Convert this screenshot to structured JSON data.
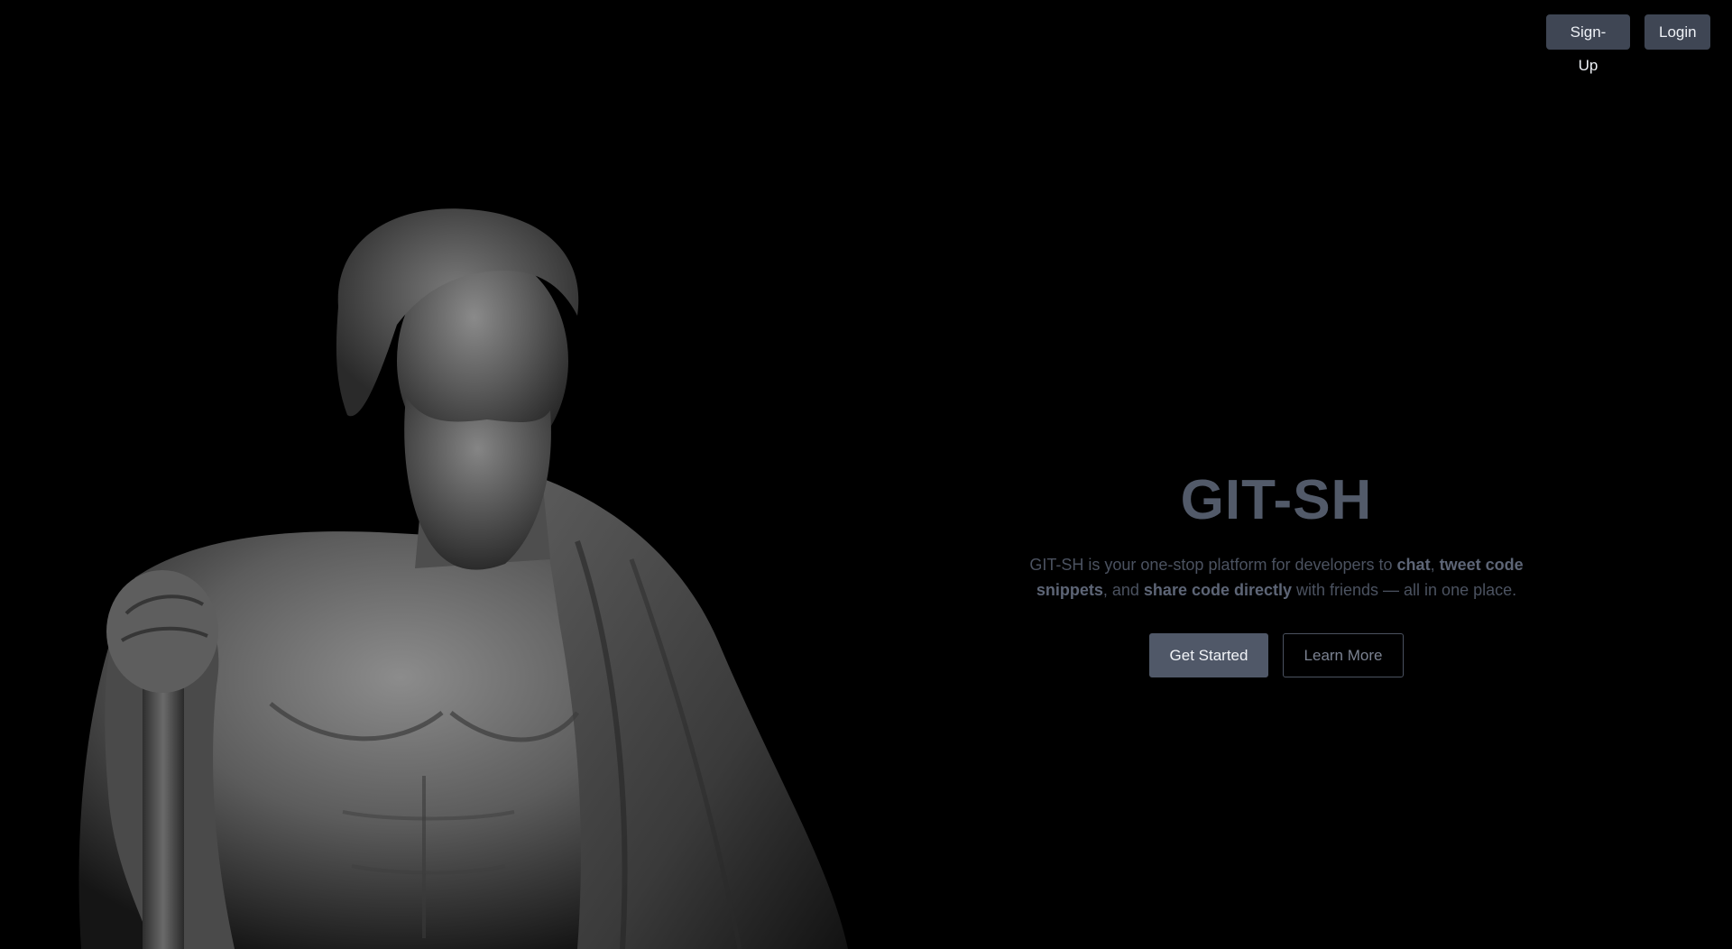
{
  "nav": {
    "signup_label": "Sign-Up",
    "login_label": "Login"
  },
  "hero": {
    "title": "GIT-SH",
    "description": {
      "part1": "GIT-SH is your one-stop platform for developers to ",
      "bold1": "chat",
      "part2": ", ",
      "bold2": "tweet code snippets",
      "part3": ", and ",
      "bold3": "share code directly",
      "part4": " with friends — all in one place."
    },
    "primary_cta": "Get Started",
    "secondary_cta": "Learn More"
  },
  "background_image": {
    "icon": "greek-statue-image"
  },
  "colors": {
    "background": "#000000",
    "button": "#3f4654",
    "title": "#525a69"
  }
}
